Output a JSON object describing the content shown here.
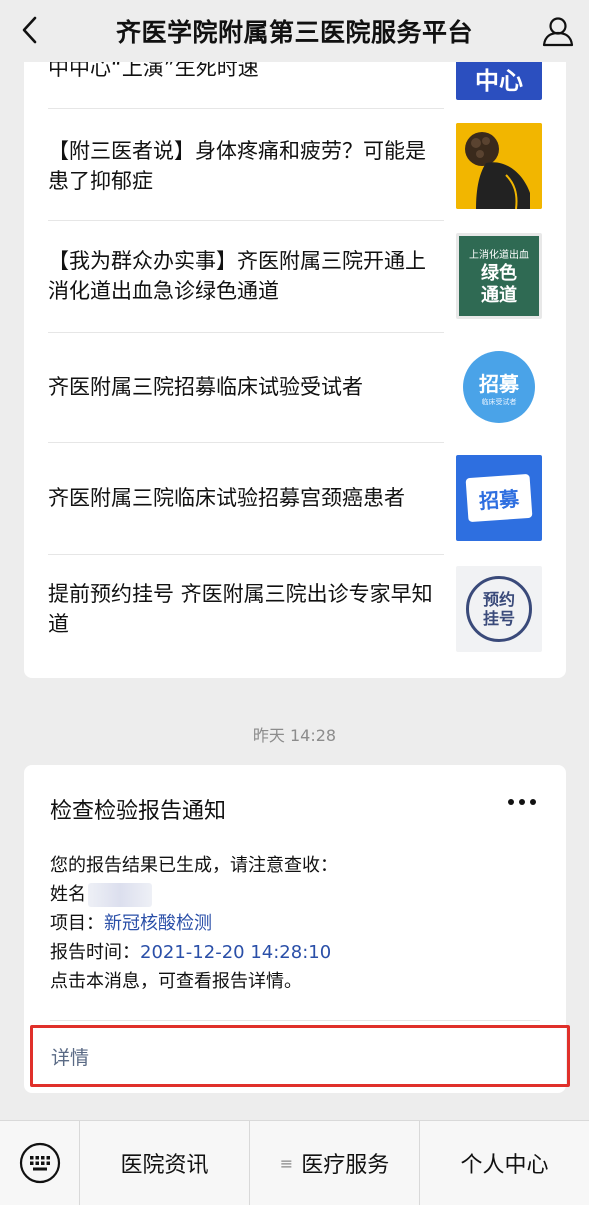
{
  "header": {
    "title": "齐医学院附属第三医院服务平台"
  },
  "news": {
    "items": [
      {
        "text": "中中心“上演”生死时速",
        "thumb": {
          "label": "中心",
          "bg": "#2b4fbf",
          "fg": "#ffffff"
        }
      },
      {
        "text": "【附三医者说】身体疼痛和疲劳？可能是患了抑郁症",
        "thumb": {
          "label": "",
          "bg": "#f2b600",
          "fg": "#222222"
        }
      },
      {
        "text": "【我为群众办实事】齐医附属三院开通上消化道出血急诊绿色通道",
        "thumb": {
          "label_top": "上消化道出血",
          "label_main": "绿色通道",
          "bg": "#2f6a53",
          "fg": "#ffffff"
        }
      },
      {
        "text": "齐医附属三院招募临床试验受试者",
        "thumb": {
          "label": "招募",
          "sub": "临床受试者",
          "bg": "#4aa3e8",
          "fg": "#ffffff"
        }
      },
      {
        "text": "齐医附属三院临床试验招募宫颈癌患者",
        "thumb": {
          "label": "招募",
          "bg": "#2e6fe0",
          "fg": "#ffffff"
        }
      },
      {
        "text": "提前预约挂号 齐医附属三院出诊专家早知道",
        "thumb": {
          "label": "预约挂号",
          "bg": "#f1f2f4",
          "fg": "#3a4a7a"
        }
      }
    ]
  },
  "timestamp": "昨天 14:28",
  "notice": {
    "title": "检查检验报告通知",
    "line1": "您的报告结果已生成，请注意查收：",
    "name_label": "姓名",
    "project_label": "项目：",
    "project_value": "新冠核酸检测",
    "time_label": "报告时间：",
    "time_value": "2021-12-20 14:28:10",
    "line_last": "点击本消息，可查看报告详情。",
    "detail_label": "详情"
  },
  "bottom_menu": {
    "items": [
      "医院资讯",
      "医疗服务",
      "个人中心"
    ]
  },
  "colors": {
    "link": "#2a4fa8",
    "highlight_border": "#e0302a"
  }
}
